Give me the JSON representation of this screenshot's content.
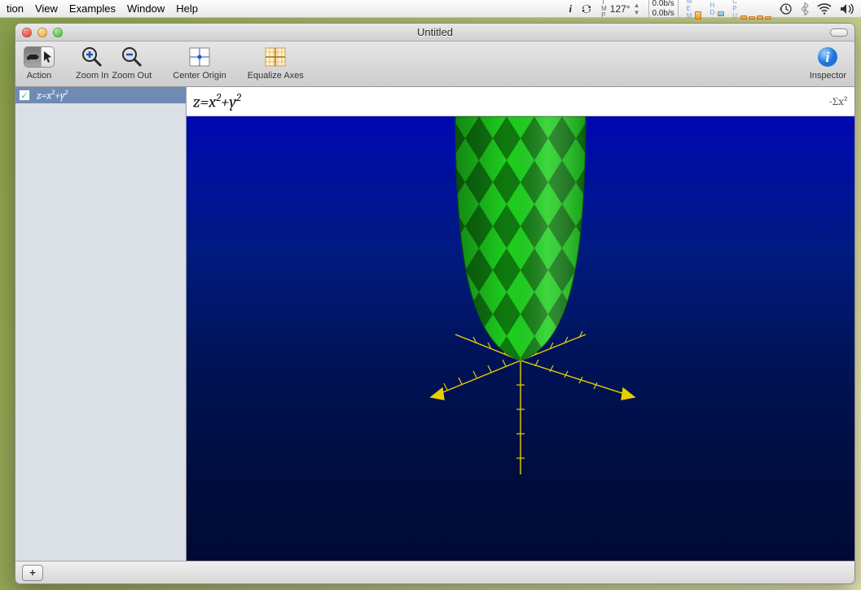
{
  "menubar": {
    "items": [
      "tion",
      "View",
      "Examples",
      "Window",
      "Help"
    ],
    "status": {
      "temperature": "127°",
      "net_up": "0.0b/s",
      "net_down": "0.0b/s"
    }
  },
  "window": {
    "title": "Untitled"
  },
  "toolbar": {
    "action": "Action",
    "zoom_in": "Zoom In",
    "zoom_out": "Zoom Out",
    "center_origin": "Center Origin",
    "equalize_axes": "Equalize Axes",
    "inspector": "Inspector"
  },
  "sidebar": {
    "items": [
      {
        "checked": true,
        "formula_html": "z=x<sup>2</sup>+y<sup>2</sup>"
      }
    ]
  },
  "formula_bar": {
    "formula_html": "z=x<sup>2</sup>+y<sup>2</sup>",
    "sigma_label": "-Σx²"
  },
  "bottom": {
    "add_label": "+"
  },
  "chart_data": {
    "type": "surface3d",
    "equation": "z = x^2 + y^2",
    "description": "Elliptic paraboloid opening upward along +z",
    "axes": {
      "x": {
        "range": [
          -3,
          3
        ],
        "ticks": 6,
        "arrow": true,
        "color": "#e6d000"
      },
      "y": {
        "range": [
          -3,
          3
        ],
        "ticks": 6,
        "arrow": true,
        "color": "#e6d000"
      },
      "z": {
        "range": [
          -3,
          9
        ],
        "ticks": 6,
        "arrow": false,
        "color": "#e6d000"
      }
    },
    "surface": {
      "color_primary": "#22dd22",
      "color_secondary": "#177a17",
      "pattern": "diamond-checker"
    },
    "background": "#001a66",
    "view": {
      "azimuth_deg": 40,
      "elevation_deg": 18
    }
  }
}
